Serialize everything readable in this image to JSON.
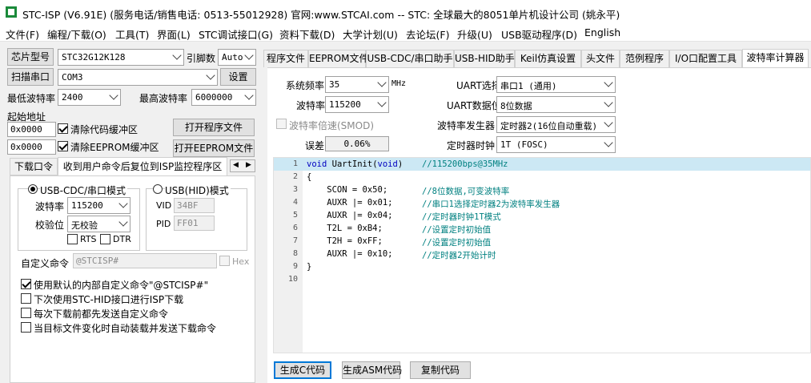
{
  "title": "STC-ISP (V6.91E) (服务电话/销售电话: 0513-55012928) 官网:www.STCAI.com  -- STC: 全球最大的8051单片机设计公司 (姚永平)",
  "menu": [
    "文件(F)",
    "编程/下载(O)",
    "工具(T)",
    "界面(L)",
    "STC调试接口(G)",
    "资料下载(D)",
    "大学计划(U)",
    "去论坛(F)",
    "升级(U)",
    "USB驱动程序(D)",
    "English"
  ],
  "left": {
    "chip_label": "芯片型号",
    "chip_value": "STC32G12K128",
    "pins_label": "引脚数",
    "pins_value": "Auto",
    "scan_label": "扫描串口",
    "port_value": "COM3",
    "settings_label": "设置",
    "min_baud_label": "最低波特率",
    "min_baud_value": "2400",
    "max_baud_label": "最高波特率",
    "max_baud_value": "6000000",
    "start_addr_label": "起始地址",
    "addr1": "0x0000",
    "clear_code_label": "清除代码缓冲区",
    "open_prog_label": "打开程序文件",
    "addr2": "0x0000",
    "clear_eeprom_label": "清除EEPROM缓冲区",
    "open_eeprom_label": "打开EEPROM文件",
    "tab_download": "下载口令",
    "tab_reset": "收到用户命令后复位到ISP监控程序区",
    "usb_cdc_label": "USB-CDC/串口模式",
    "usb_hid_label": "USB(HID)模式",
    "baud_label": "波特率",
    "baud_value": "115200",
    "parity_label": "校验位",
    "parity_value": "无校验",
    "vid_label": "VID",
    "vid_value": "34BF",
    "pid_label": "PID",
    "pid_value": "FF01",
    "rts_label": "RTS",
    "dtr_label": "DTR",
    "custom_cmd_label": "自定义命令",
    "custom_cmd_value": "@STCISP#",
    "hex_label": "Hex",
    "options": [
      {
        "label": "使用默认的内部自定义命令\"@STCISP#\"",
        "checked": true
      },
      {
        "label": "下次使用STC-HID接口进行ISP下载",
        "checked": false
      },
      {
        "label": "每次下载前都先发送自定义命令",
        "checked": false
      },
      {
        "label": "当目标文件变化时自动装载并发送下载命令",
        "checked": false
      }
    ]
  },
  "tabs": [
    "程序文件",
    "EEPROM文件",
    "USB-CDC/串口助手",
    "USB-HID助手",
    "Keil仿真设置",
    "头文件",
    "范例程序",
    "I/O口配置工具",
    "波特率计算器"
  ],
  "calc": {
    "sysfreq_label": "系统频率",
    "sysfreq_value": "35",
    "mhz": "MHz",
    "uart_sel_label": "UART选择",
    "uart_sel_value": "串口1 (通用)",
    "baud_label": "波特率",
    "baud_value": "115200",
    "uart_bits_label": "UART数据位",
    "uart_bits_value": "8位数据",
    "baud_double_label": "波特率倍速(SMOD)",
    "baud_gen_label": "波特率发生器",
    "baud_gen_value": "定时器2(16位自动重载)",
    "error_label": "误差",
    "error_value": "0.06%",
    "timer_clk_label": "定时器时钟",
    "timer_clk_value": "1T  (FOSC)"
  },
  "code": {
    "line_numbers": [
      "1",
      "2",
      "3",
      "4",
      "5",
      "6",
      "7",
      "8",
      "9",
      "10"
    ],
    "lines": [
      {
        "kw": "void",
        "fn": " UartInit(",
        "kw2": "void",
        "rest": ")",
        "cm": "//115200bps@35MHz"
      },
      {
        "text": "{"
      },
      {
        "text": "    SCON = 0x50;",
        "cm": "//8位数据,可变波特率"
      },
      {
        "text": "    AUXR |= 0x01;",
        "cm": "//串口1选择定时器2为波特率发生器"
      },
      {
        "text": "    AUXR |= 0x04;",
        "cm": "//定时器时钟1T模式"
      },
      {
        "text": "    T2L = 0xB4;",
        "cm": "//设置定时初始值"
      },
      {
        "text": "    T2H = 0xFF;",
        "cm": "//设置定时初始值"
      },
      {
        "text": "    AUXR |= 0x10;",
        "cm": "//定时器2开始计时"
      },
      {
        "text": "}"
      },
      {
        "text": ""
      }
    ]
  },
  "buttons": {
    "gen_c": "生成C代码",
    "gen_asm": "生成ASM代码",
    "copy": "复制代码"
  }
}
